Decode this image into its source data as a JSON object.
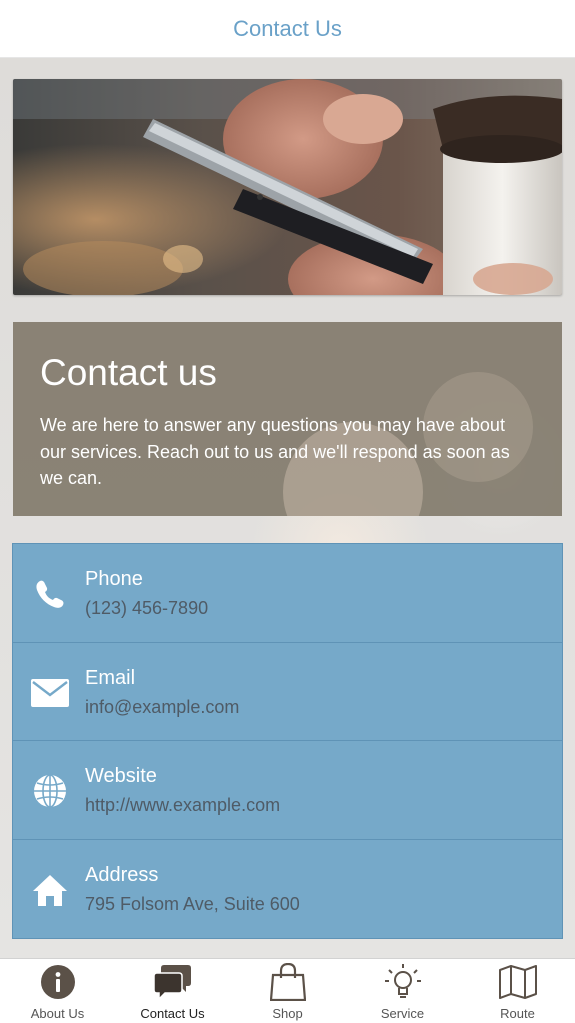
{
  "header": {
    "title": "Contact Us"
  },
  "intro": {
    "heading": "Contact us",
    "text": "We are here to answer any questions you may have about our services. Reach out to us and we'll respond as soon as we can."
  },
  "contacts": [
    {
      "label": "Phone",
      "value": "(123) 456-7890",
      "icon": "phone-icon"
    },
    {
      "label": "Email",
      "value": "info@example.com",
      "icon": "envelope-icon"
    },
    {
      "label": "Website",
      "value": "http://www.example.com",
      "icon": "globe-icon"
    },
    {
      "label": "Address",
      "value": "795 Folsom Ave, Suite 600",
      "icon": "home-icon"
    }
  ],
  "tabs": [
    {
      "label": "About Us",
      "icon": "info-icon",
      "active": false
    },
    {
      "label": "Contact Us",
      "icon": "chat-bubbles-icon",
      "active": true
    },
    {
      "label": "Shop",
      "icon": "shopping-bag-icon",
      "active": false
    },
    {
      "label": "Service",
      "icon": "lightbulb-icon",
      "active": false
    },
    {
      "label": "Route",
      "icon": "map-icon",
      "active": false
    }
  ],
  "colors": {
    "header_text": "#6aa1c8",
    "contact_panel": "#76a9c9",
    "intro_panel": "#7d7566",
    "tab_icon": "#5b5148"
  }
}
